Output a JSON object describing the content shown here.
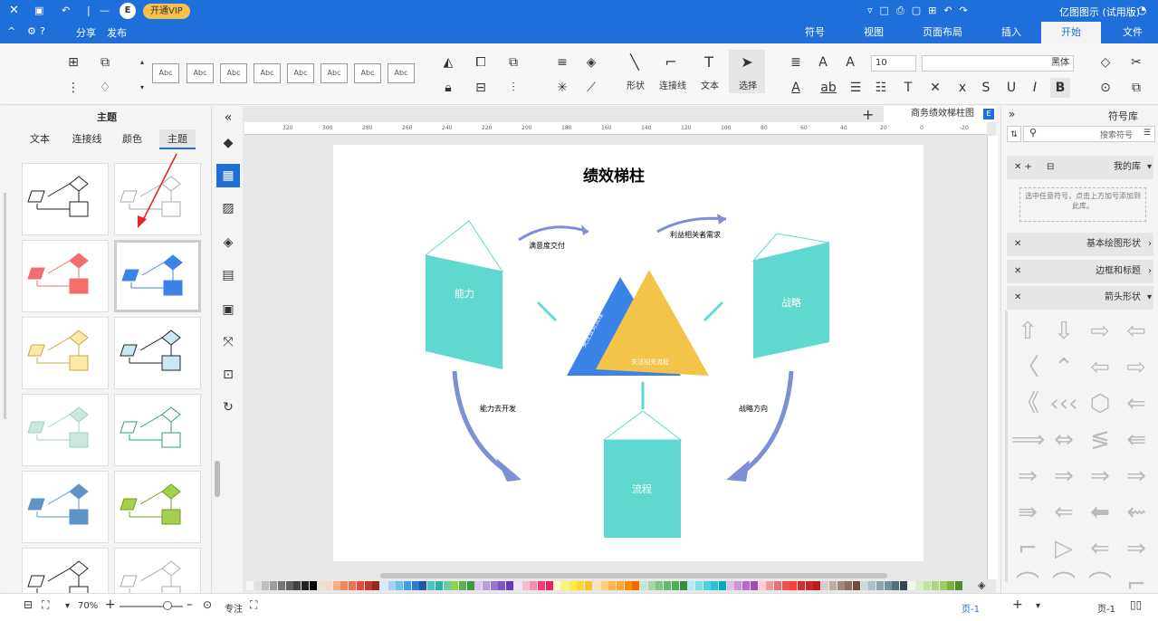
{
  "title_bar": {
    "app_name": "亿图图示 (试用版)",
    "vip_label": "开通VIP",
    "badge": "E",
    "publish": "发布",
    "share": "分享",
    "help": "?"
  },
  "menu_tabs": [
    "文件",
    "开始",
    "插入",
    "页面布局",
    "视图",
    "符号"
  ],
  "ribbon": {
    "select_label": "选择",
    "text_label": "文本",
    "connector_label": "连接线",
    "shape_label": "形状",
    "font_name": "黑体",
    "font_size": "10",
    "style_box": "Abc"
  },
  "left_panel": {
    "title": "主题",
    "tabs": [
      "主题",
      "颜色",
      "连接线",
      "文本"
    ]
  },
  "doc_tab": {
    "name": "商务绩效梯柱图"
  },
  "ruler_ticks": [
    "-20",
    "0",
    "20",
    "40",
    "60",
    "80",
    "100",
    "120",
    "140",
    "160",
    "180",
    "200",
    "220",
    "240",
    "260",
    "280",
    "300",
    "320"
  ],
  "diagram": {
    "title": "绩效梯柱",
    "left_panel": "能力",
    "right_panel": "战略",
    "bottom_panel": "流程",
    "arrow_tl": "满意度交付",
    "arrow_tr": "利益相关者需求",
    "arrow_bl": "能力去开发",
    "arrow_br": "战略方向",
    "tri_left": "关注业务流程",
    "tri_bottom": "关注相关流程"
  },
  "right_panel": {
    "title": "符号库",
    "search_placeholder": "搜索符号",
    "sections": [
      "我的库",
      "基本绘图形状",
      "边框和标题",
      "箭头形状"
    ],
    "my_lib_hint": "选中任意符号，点击上方加号添加到此库。"
  },
  "status": {
    "zoom": "70%",
    "focus": "专注",
    "page_tab": "页-1",
    "page_label": "页-1"
  },
  "colors": {
    "accent": "#1e6fd9",
    "teal": "#5fd8cf",
    "yellow": "#f3c34a",
    "blue": "#3b83e6"
  }
}
